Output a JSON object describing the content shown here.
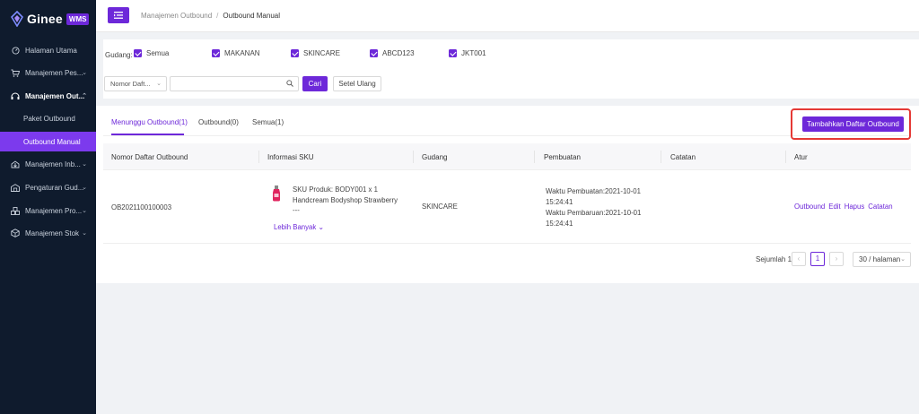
{
  "brand": {
    "name": "Ginee",
    "badge": "WMS"
  },
  "sidebar": {
    "items": [
      {
        "label": "Halaman Utama",
        "icon": "dashboard-icon"
      },
      {
        "label": "Manajemen Pes...",
        "icon": "cart-icon"
      },
      {
        "label": "Manajemen Out...",
        "icon": "headset-icon",
        "open": true
      },
      {
        "label": "Paket Outbound",
        "sub": true
      },
      {
        "label": "Outbound Manual",
        "sub": true,
        "active": true
      },
      {
        "label": "Manajemen Inb...",
        "icon": "inbound-icon"
      },
      {
        "label": "Pengaturan Gud...",
        "icon": "warehouse-icon"
      },
      {
        "label": "Manajemen Pro...",
        "icon": "product-icon"
      },
      {
        "label": "Manajemen Stok",
        "icon": "stock-icon"
      }
    ]
  },
  "breadcrumb": {
    "parent": "Manajemen Outbound",
    "separator": "/",
    "current": "Outbound Manual"
  },
  "filter": {
    "warehouse_label": "Gudang:",
    "warehouses": [
      "Semua",
      "MAKANAN",
      "SKINCARE",
      "ABCD123",
      "JKT001"
    ],
    "search_type": "Nomor Daft...",
    "search_value": "",
    "search_button": "Cari",
    "reset_button": "Setel Ulang"
  },
  "tabs": [
    "Menunggu Outbound(1)",
    "Outbound(0)",
    "Semua(1)"
  ],
  "add_button": "Tambahkan Daftar Outbound",
  "table": {
    "headers": [
      "Nomor Daftar Outbound",
      "Informasi SKU",
      "Gudang",
      "Pembuatan",
      "Catatan",
      "Atur"
    ],
    "row": {
      "number": "OB2021100100003",
      "sku_line": "SKU Produk:  BODY001 x 1",
      "product_name": "Handcream Bodyshop Strawberry",
      "ellipsis": "---",
      "more": "Lebih Banyak",
      "warehouse": "SKINCARE",
      "created_1": "Waktu Pembuatan:2021-10-01",
      "created_2": "15:24:41",
      "updated_1": "Waktu Pembaruan:2021-10-01",
      "updated_2": "15:24:41",
      "actions": [
        "Outbound",
        "Edit",
        "Hapus",
        "Catatan"
      ]
    }
  },
  "pagination": {
    "total": "Sejumlah 1",
    "page": "1",
    "page_size": "30 / halaman"
  },
  "colors": {
    "primary": "#6d28d9",
    "sidebar": "#0f1b2d",
    "highlight": "#e53935"
  }
}
